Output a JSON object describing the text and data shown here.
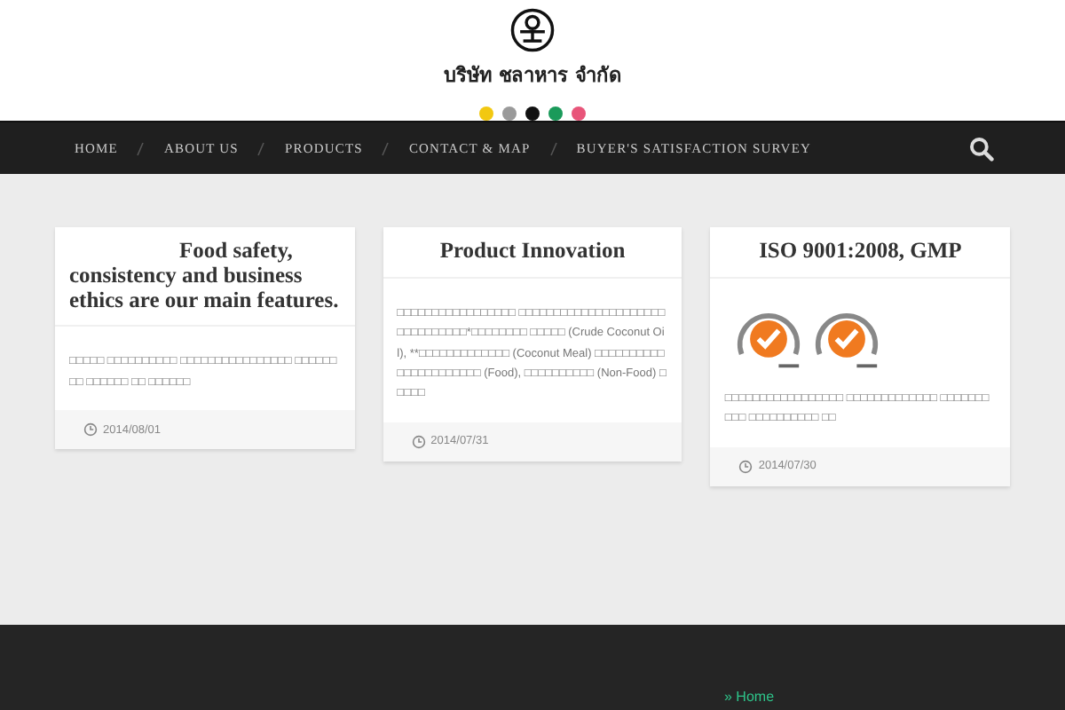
{
  "header": {
    "company_name": "บริษัท ชลาหาร จำกัด",
    "dots": [
      {
        "color": "#f2c811"
      },
      {
        "color": "#9a9a9a"
      },
      {
        "color": "#111111"
      },
      {
        "color": "#1a9a5a"
      },
      {
        "color": "#e8557a"
      }
    ]
  },
  "nav": {
    "items": [
      {
        "label": "HOME"
      },
      {
        "label": "ABOUT US"
      },
      {
        "label": "PRODUCTS"
      },
      {
        "label": "CONTACT & MAP"
      },
      {
        "label": "BUYER'S SATISFACTION SURVEY"
      }
    ]
  },
  "posts": [
    {
      "kind": "text",
      "title": "Food safety, consistency and business ethics are our main features.",
      "excerpt": "□□□□□ □□□□□□□□□□ □□□□□□□□□□□□□□□□ □□□□□□□□ □□□□□□ □□ □□□□□□",
      "date": "2014/08/01"
    },
    {
      "kind": "text",
      "title": "Product Innovation",
      "excerpt": "□□□□□□□□□□□□□□□□□ □□□□□□□□□□□□□□□□□□□□□□□□□□□□□□□*□□□□□□□□ □□□□□ (Crude Coconut Oil), **□□□□□□□□□□□□□ (Coconut Meal) □□□□□□□□□□□□□□□□□□□□□□ (Food), □□□□□□□□□□ (Non-Food) □□□□□",
      "date": "2014/07/31"
    },
    {
      "kind": "badges",
      "title": "ISO 9001:2008, GMP",
      "excerpt": "□□□□□□□□□□□□□□□□□ □□□□□□□□□□□□□ □□□□□□□□□□ □□□□□□□□□□ □□",
      "date": "2014/07/30"
    }
  ],
  "footer": {
    "links": [
      {
        "label": "» Home"
      }
    ]
  }
}
